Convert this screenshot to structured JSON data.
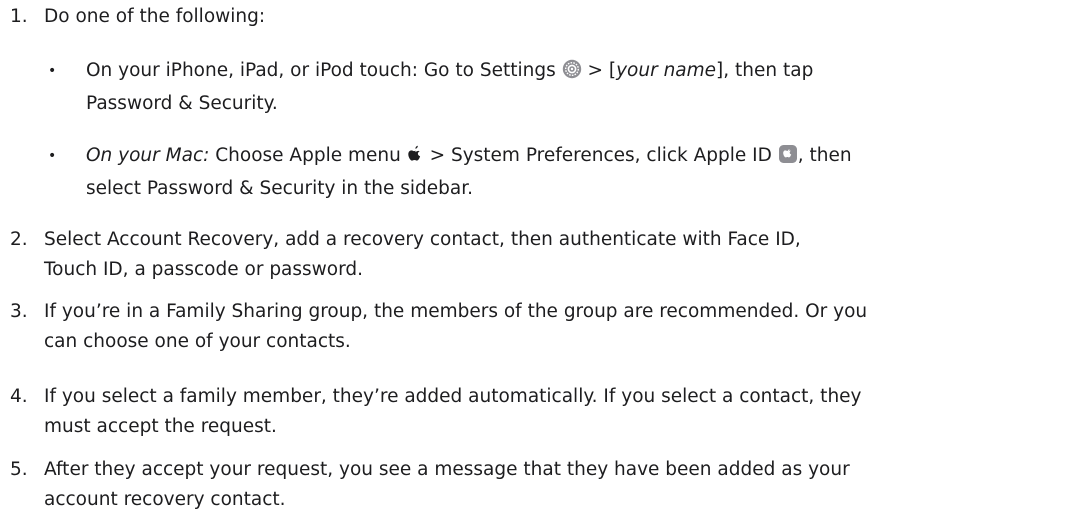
{
  "steps": [
    {
      "number": "1.",
      "text": "Do one of the following:",
      "bullets": [
        {
          "marker": "•",
          "prefix": "On your iPhone, iPad, or iPod touch: Go to Settings",
          "settings_icon": "settings-gear-icon",
          "middle_open": " > [",
          "your_name": "your name",
          "middle_close": "], then tap",
          "line2": "Password & Security."
        },
        {
          "marker": "•",
          "mac_label": "On your Mac:",
          "choose": " Choose Apple menu ",
          "apple_icon": "apple-logo-icon",
          "system_prefs": " > System Preferences, click Apple ID ",
          "appleid_icon": "apple-id-icon",
          "then": ", then",
          "line2": "select Password & Security in the sidebar."
        }
      ]
    },
    {
      "number": "2.",
      "line1": "Select Account Recovery, add a recovery contact, then authenticate with Face ID,",
      "line2": "Touch ID, a passcode or password."
    },
    {
      "number": "3.",
      "line1": "If you’re in a Family Sharing group, the members of the group are recommended. Or you",
      "line2": "can choose one of your contacts."
    },
    {
      "number": "4.",
      "line1": "If you select a family member, they’re added automatically. If you select a contact, they",
      "line2": "must accept the request."
    },
    {
      "number": "5.",
      "line1": "After they accept your request, you see a message that they have been added as your",
      "line2": "account recovery contact."
    }
  ],
  "colors": {
    "text": "#1d1d1f",
    "icon_gray": "#8e8e93"
  }
}
